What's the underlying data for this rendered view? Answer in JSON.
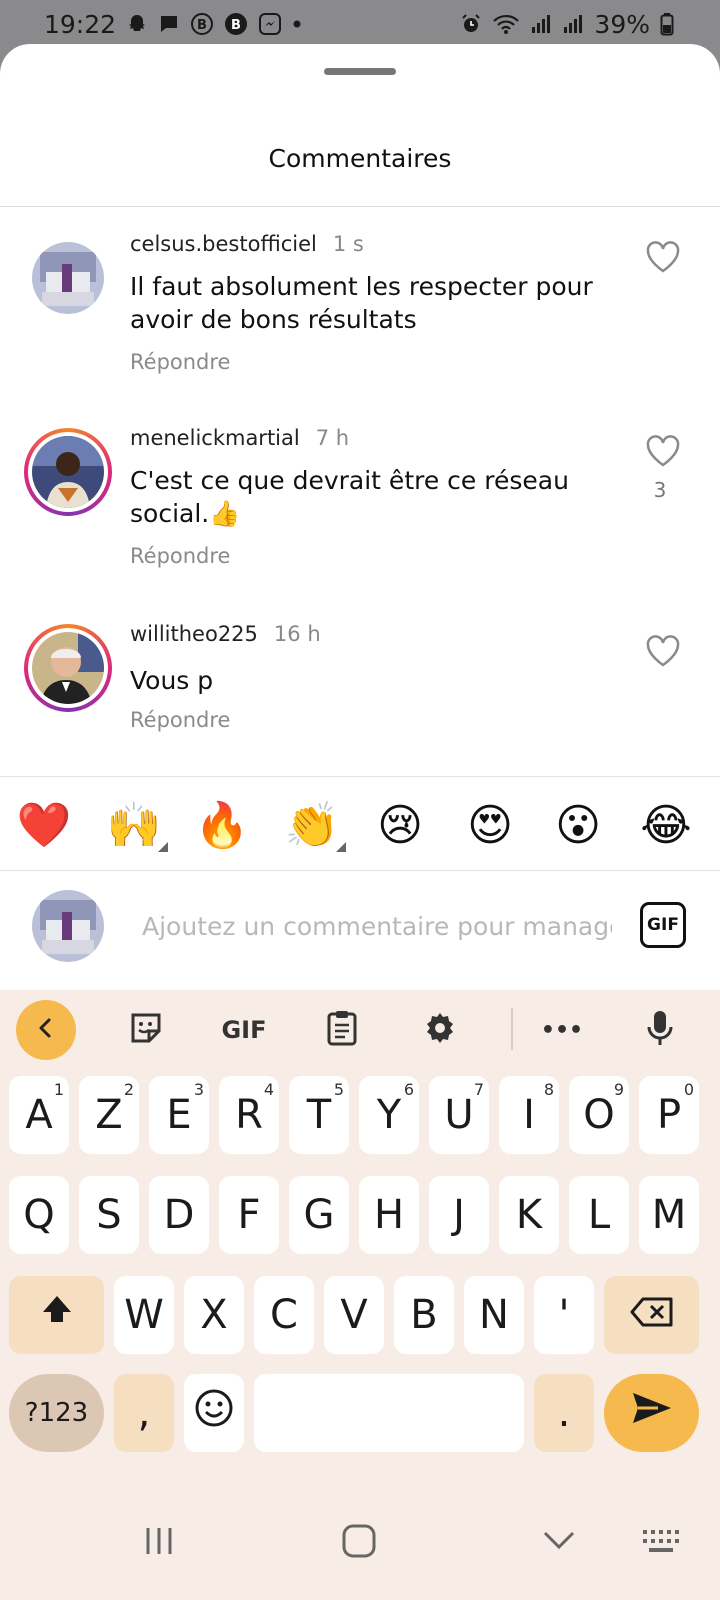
{
  "status_bar": {
    "time": "19:22",
    "battery": "39%",
    "left_icons": [
      "snapchat-icon",
      "message-icon",
      "b-badge-icon",
      "b-badge-filled-icon",
      "messenger-icon",
      "dot-icon"
    ],
    "right_icons": [
      "alarm-icon",
      "wifi-icon",
      "signal-icon",
      "signal-icon",
      "battery-icon"
    ]
  },
  "sheet": {
    "title": "Commentaires"
  },
  "comments": [
    {
      "username": "celsus.bestofficiel",
      "time": "1 s",
      "text": "Il faut absolument les respecter pour avoir de bons résultats",
      "reply": "Répondre",
      "likes": ""
    },
    {
      "username": "menelickmartial",
      "time": "7 h",
      "text": "C'est ce que devrait être ce réseau social.👍",
      "reply": "Répondre",
      "likes": "3"
    },
    {
      "username": "willitheo225",
      "time": "16 h",
      "text": "Vous p",
      "reply": "Répondre",
      "likes": ""
    }
  ],
  "emoji_bar": [
    "❤️",
    "🙌",
    "🔥",
    "👏",
    "😢",
    "😍",
    "😮",
    "😂"
  ],
  "composer": {
    "placeholder": "Ajoutez un commentaire pour manage",
    "gif_label": "GIF"
  },
  "keyboard": {
    "toolbar": {
      "gif_label": "GIF",
      "more_label": "•••"
    },
    "row1": [
      {
        "key": "A",
        "hint": "1"
      },
      {
        "key": "Z",
        "hint": "2"
      },
      {
        "key": "E",
        "hint": "3"
      },
      {
        "key": "R",
        "hint": "4"
      },
      {
        "key": "T",
        "hint": "5"
      },
      {
        "key": "Y",
        "hint": "6"
      },
      {
        "key": "U",
        "hint": "7"
      },
      {
        "key": "I",
        "hint": "8"
      },
      {
        "key": "O",
        "hint": "9"
      },
      {
        "key": "P",
        "hint": "0"
      }
    ],
    "row2": [
      "Q",
      "S",
      "D",
      "F",
      "G",
      "H",
      "J",
      "K",
      "L",
      "M"
    ],
    "row3": [
      "W",
      "X",
      "C",
      "V",
      "B",
      "N",
      "'"
    ],
    "row4": {
      "symbols": "?123",
      "comma": ",",
      "period": "."
    }
  }
}
